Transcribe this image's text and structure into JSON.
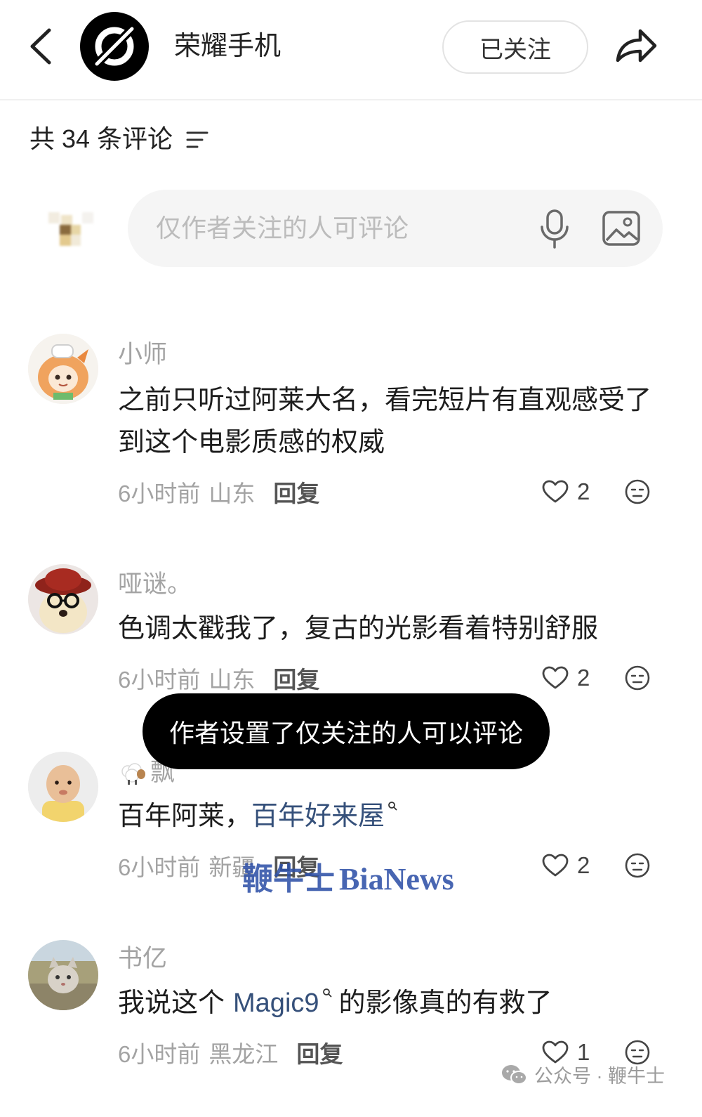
{
  "header": {
    "back_icon": "back-arrow-icon",
    "logo_icon": "honor-logo-icon",
    "account_name": "荣耀手机",
    "follow_label": "已关注",
    "share_icon": "share-icon"
  },
  "comment_summary": {
    "count_label": "共 34 条评论",
    "sort_icon": "sort-filter-icon"
  },
  "composer": {
    "placeholder": "仅作者关注的人可评论",
    "mic_icon": "microphone-icon",
    "image_icon": "image-icon"
  },
  "comments": [
    {
      "author": "小师",
      "text_lines": [
        "之前只听过阿莱大名，看完短片有直观感受了",
        "到这个电影质感的权威"
      ],
      "time": "6小时前",
      "location": "山东",
      "reply_label": "回复",
      "likes": "2"
    },
    {
      "author": "哑谜。",
      "text_lines": [
        "色调太戳我了，复古的光影看着特别舒服"
      ],
      "time": "6小时前",
      "location": "山东",
      "reply_label": "回复",
      "likes": "2"
    },
    {
      "author_emoji": "sheep-emoji-icon",
      "author": "飘",
      "segments": [
        {
          "text": "百年阿莱，",
          "link": false
        },
        {
          "text": "百年好来屋",
          "link": true
        }
      ],
      "time": "6小时前",
      "location": "新疆",
      "reply_label": "回复",
      "likes": "2"
    },
    {
      "author": "书亿",
      "segments": [
        {
          "text": "我说这个",
          "link": false
        },
        {
          "text": "Magic9",
          "link": true
        },
        {
          "text": "的影像真的有救了",
          "link": false
        }
      ],
      "time": "6小时前",
      "location": "黑龙江",
      "reply_label": "回复",
      "likes": "1"
    }
  ],
  "toast": {
    "message": "作者设置了仅关注的人可以评论"
  },
  "watermarks": {
    "overlay_cn": "鞭牛士",
    "overlay_en": "BiaNews",
    "footer_icon": "wechat-icon",
    "footer": "公众号 · 鞭牛士"
  },
  "colors": {
    "link": "#35507a",
    "toast_background": "#000000",
    "watermark_blue": "#2f51a8",
    "composer_background": "#f5f5f5"
  }
}
